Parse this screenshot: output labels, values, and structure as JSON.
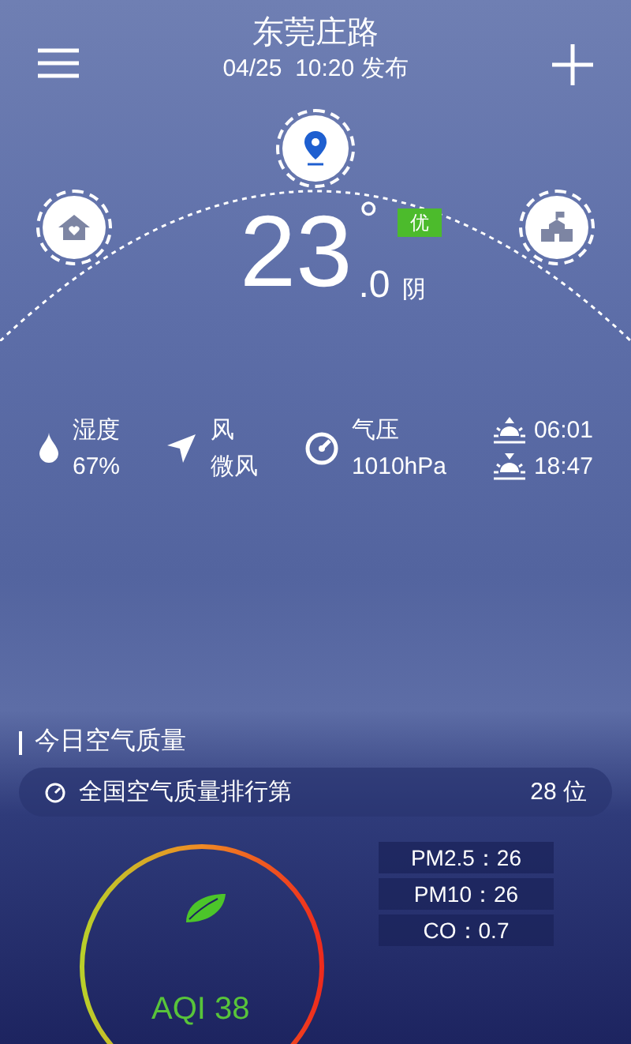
{
  "header": {
    "city": "东莞庄路",
    "published": "04/25  10:20 发布"
  },
  "current": {
    "temp": "23",
    "decimal": ".0",
    "degree": "°",
    "condition": "阴",
    "aqi_badge": {
      "label": "优",
      "color": "#4cbb2c"
    }
  },
  "stats": [
    {
      "kind": "humidity",
      "label": "湿度",
      "value": "67%"
    },
    {
      "kind": "wind",
      "label": "风",
      "value": "微风"
    },
    {
      "kind": "pressure",
      "label": "气压",
      "value": "1010hPa"
    },
    {
      "kind": "sun",
      "sunrise": "06:01",
      "sunset": "18:47"
    }
  ],
  "air_quality": {
    "title": "今日空气质量",
    "rank_label": "全国空气质量排行第",
    "rank_value": "28 位",
    "aqi": "AQI 38",
    "pollutants": [
      "PM2.5：26",
      "PM10：26",
      "CO：0.7"
    ]
  }
}
